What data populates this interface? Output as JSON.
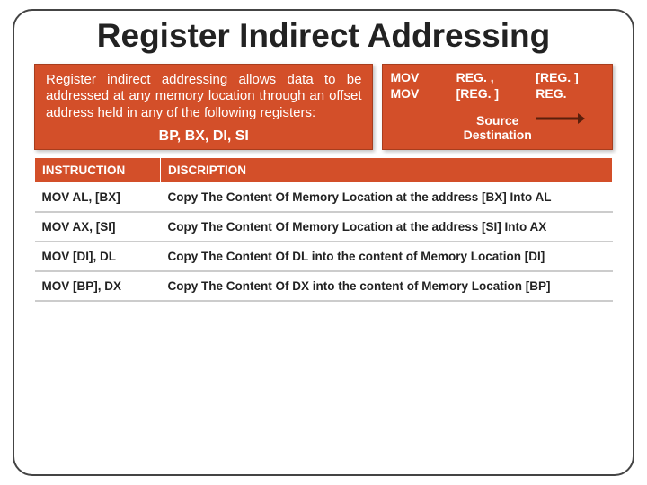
{
  "title": "Register Indirect Addressing",
  "description": "Register indirect addressing allows data to be addressed at any memory location through an offset address held in any of the following registers:",
  "registers_line": "BP, BX, DI, SI",
  "syntax": {
    "row1": {
      "mov": "MOV",
      "dst": "REG. ,",
      "src": "[REG. ]"
    },
    "row2": {
      "mov": "MOV",
      "dst": "[REG. ]",
      "src": "REG."
    },
    "caption_src": "Source",
    "caption_dst": "Destination"
  },
  "table": {
    "headers": {
      "instr": "INSTRUCTION",
      "desc": "DISCRIPTION"
    },
    "rows": [
      {
        "instr": "MOV AL, [BX]",
        "desc": "Copy The Content Of Memory Location at the address [BX] Into AL"
      },
      {
        "instr": "MOV AX, [SI]",
        "desc": "Copy The Content Of Memory Location at the address [SI] Into AX"
      },
      {
        "instr": "MOV [DI], DL",
        "desc": "Copy The Content Of DL into the content of Memory Location [DI]"
      },
      {
        "instr": "MOV [BP], DX",
        "desc": "Copy The Content Of DX into the content of Memory Location [BP]"
      }
    ]
  }
}
